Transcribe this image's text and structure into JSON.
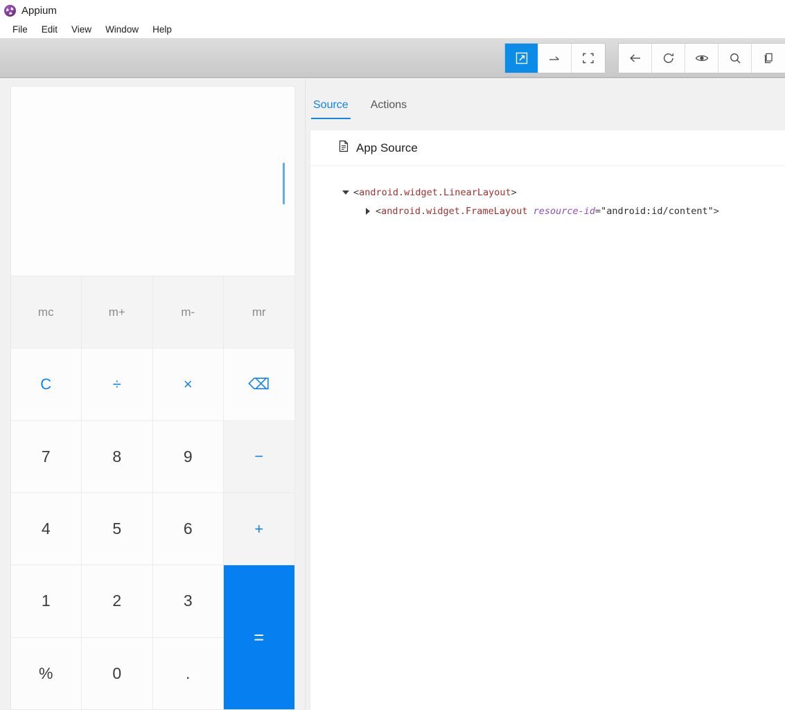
{
  "window": {
    "title": "Appium",
    "logo_icon": "appium-logo-icon"
  },
  "menubar": {
    "items": [
      {
        "label": "File"
      },
      {
        "label": "Edit"
      },
      {
        "label": "View"
      },
      {
        "label": "Window"
      },
      {
        "label": "Help"
      }
    ]
  },
  "toolbar": {
    "accent_color": "#0c8ce9",
    "groups": [
      {
        "name": "interaction-mode-group",
        "buttons": [
          {
            "icon": "select-element-icon",
            "active": true
          },
          {
            "icon": "swipe-arrow-icon",
            "active": false
          },
          {
            "icon": "crop-scan-icon",
            "active": false
          }
        ]
      },
      {
        "name": "navigation-group",
        "buttons": [
          {
            "icon": "back-arrow-icon",
            "active": false
          },
          {
            "icon": "refresh-icon",
            "active": false
          },
          {
            "icon": "eye-icon",
            "active": false
          },
          {
            "icon": "search-icon",
            "active": false
          },
          {
            "icon": "copy-pages-icon",
            "active": false
          }
        ]
      }
    ]
  },
  "device": {
    "name": "calculator-screenshot",
    "display": {
      "value": "",
      "caret_color": "#5dadf5"
    },
    "keys": [
      {
        "label": "mc",
        "type": "mem",
        "name": "key-mc"
      },
      {
        "label": "m+",
        "type": "mem",
        "name": "key-m-plus"
      },
      {
        "label": "m-",
        "type": "mem",
        "name": "key-m-minus"
      },
      {
        "label": "mr",
        "type": "mem",
        "name": "key-mr"
      },
      {
        "label": "C",
        "type": "op",
        "name": "key-clear"
      },
      {
        "label": "÷",
        "type": "op",
        "name": "key-divide"
      },
      {
        "label": "×",
        "type": "op",
        "name": "key-multiply"
      },
      {
        "label": "⌫",
        "type": "op",
        "name": "key-backspace"
      },
      {
        "label": "7",
        "type": "num",
        "name": "key-7"
      },
      {
        "label": "8",
        "type": "num",
        "name": "key-8"
      },
      {
        "label": "9",
        "type": "num",
        "name": "key-9"
      },
      {
        "label": "−",
        "type": "op-bg",
        "name": "key-minus"
      },
      {
        "label": "4",
        "type": "num",
        "name": "key-4"
      },
      {
        "label": "5",
        "type": "num",
        "name": "key-5"
      },
      {
        "label": "6",
        "type": "num",
        "name": "key-6"
      },
      {
        "label": "+",
        "type": "op-bg",
        "name": "key-plus"
      },
      {
        "label": "1",
        "type": "num",
        "name": "key-1"
      },
      {
        "label": "2",
        "type": "num",
        "name": "key-2"
      },
      {
        "label": "3",
        "type": "num",
        "name": "key-3"
      },
      {
        "label": "=",
        "type": "equals",
        "name": "key-equals"
      },
      {
        "label": "%",
        "type": "num",
        "name": "key-percent"
      },
      {
        "label": "0",
        "type": "num",
        "name": "key-0"
      },
      {
        "label": ".",
        "type": "num",
        "name": "key-decimal"
      }
    ]
  },
  "inspector": {
    "tabs": [
      {
        "label": "Source",
        "active": true
      },
      {
        "label": "Actions",
        "active": false
      }
    ],
    "source_card": {
      "icon": "document-icon",
      "title": "App Source",
      "tree": [
        {
          "indent": 0,
          "twisty": "expanded",
          "open_bracket": "<",
          "tag": "android.widget.LinearLayout",
          "attr": "",
          "eq": "",
          "value": "",
          "close_bracket": ">"
        },
        {
          "indent": 1,
          "twisty": "collapsed",
          "open_bracket": "<",
          "tag": "android.widget.FrameLayout",
          "attr": "resource-id",
          "eq": "=",
          "value": "\"android:id/content\"",
          "close_bracket": ">"
        }
      ]
    }
  }
}
